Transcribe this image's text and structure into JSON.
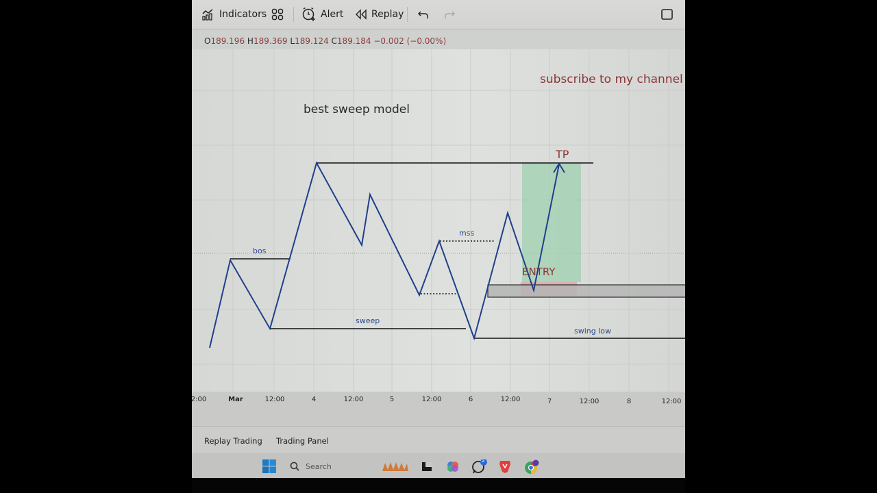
{
  "toolbar": {
    "indicators_label": "Indicators",
    "alert_label": "Alert",
    "replay_label": "Replay",
    "icons": [
      "indicators-icon",
      "layout-grid-icon",
      "alarm-add-icon",
      "replay-rewind-icon",
      "undo-icon",
      "redo-icon",
      "fullscreen-square-icon"
    ]
  },
  "ohlc": {
    "open_key": "O",
    "open": "189.196",
    "high_key": "H",
    "high": "189.369",
    "low_key": "L",
    "low": "189.124",
    "close_key": "C",
    "close": "189.184",
    "change": "−0.002 (−0.00%)"
  },
  "annotations": {
    "title": "best sweep model",
    "subscribe": "subscribe to my channel",
    "tp": "TP",
    "entry": "ENTRY",
    "bos": "bos",
    "mss": "mss",
    "sweep": "sweep",
    "swing_low": "swing low"
  },
  "colors": {
    "price_line": "#1f3f8a",
    "annotation_red": "#8c3434",
    "annotation_blue": "#2c4c8c",
    "tp_zone": "#9fd0b0",
    "sl_zone": "#d8a5a5",
    "fvg_zone": "#b8b9b8"
  },
  "time_axis": {
    "ticks": [
      "2:00",
      "Mar",
      "12:00",
      "4",
      "12:00",
      "5",
      "12:00",
      "6",
      "12:00",
      "7",
      "12:00",
      "8",
      "12:00"
    ]
  },
  "bottom_panel": {
    "tabs": [
      "Replay Trading",
      "Trading Panel"
    ]
  },
  "taskbar": {
    "search_label": "Search",
    "apps": [
      "windows-start-icon",
      "search-icon",
      "widgets-weather-icon",
      "terminal-app-icon",
      "copilot-icon",
      "whatsapp-icon",
      "brave-browser-icon",
      "chrome-icon"
    ],
    "whatsapp_badge": "2"
  }
}
